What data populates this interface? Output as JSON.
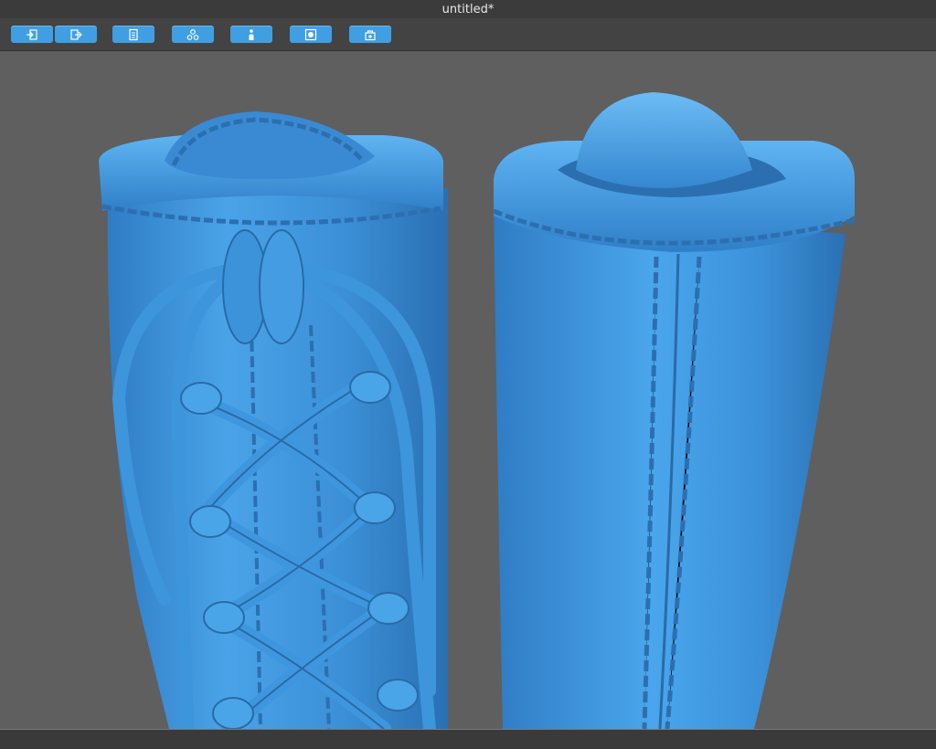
{
  "window": {
    "title": "untitled*"
  },
  "toolbar": {
    "buttons": [
      {
        "name": "import-button",
        "icon": "import-icon"
      },
      {
        "name": "export-button",
        "icon": "export-icon"
      },
      {
        "name": "document-button",
        "icon": "document-icon"
      },
      {
        "name": "components-button",
        "icon": "components-icon"
      },
      {
        "name": "figure-button",
        "icon": "figure-icon"
      },
      {
        "name": "render-button",
        "icon": "render-icon"
      },
      {
        "name": "package-button",
        "icon": "package-icon"
      }
    ]
  },
  "viewport": {
    "model_color": "#3b8fd6",
    "background_color": "#5f5f5f"
  }
}
